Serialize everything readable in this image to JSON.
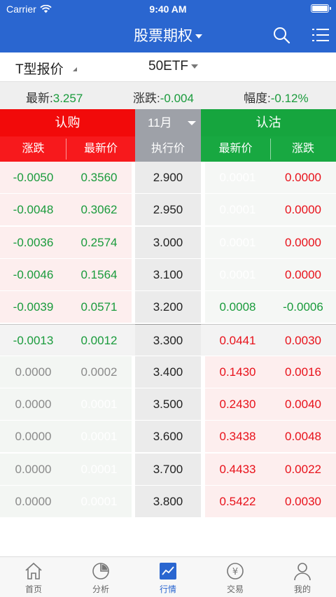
{
  "status_bar": {
    "carrier": "Carrier",
    "time": "9:40 AM"
  },
  "nav": {
    "title": "股票期权",
    "search_icon": "search-icon",
    "menu_icon": "list-menu-icon"
  },
  "filter": {
    "type": "T型报价",
    "underlying": "50ETF"
  },
  "quote": {
    "last_label": "最新:",
    "last_value": "3.257",
    "change_label": "涨跌:",
    "change_value": "-0.004",
    "pct_label": "幅度:",
    "pct_value": "-0.12%"
  },
  "table": {
    "call_header": "认购",
    "month": "11月",
    "put_header": "认沽",
    "columns": {
      "call_change": "涨跌",
      "call_last": "最新价",
      "strike": "执行价",
      "put_last": "最新价",
      "put_change": "涨跌"
    },
    "rows": [
      {
        "call_change": "-0.0050",
        "call_last": "0.3560",
        "strike": "2.900",
        "put_last": "0.0001",
        "put_change": "0.0000"
      },
      {
        "call_change": "-0.0048",
        "call_last": "0.3062",
        "strike": "2.950",
        "put_last": "0.0001",
        "put_change": "0.0000"
      },
      {
        "call_change": "-0.0036",
        "call_last": "0.2574",
        "strike": "3.000",
        "put_last": "0.0001",
        "put_change": "0.0000"
      },
      {
        "call_change": "-0.0046",
        "call_last": "0.1564",
        "strike": "3.100",
        "put_last": "0.0001",
        "put_change": "0.0000"
      },
      {
        "call_change": "-0.0039",
        "call_last": "0.0571",
        "strike": "3.200",
        "put_last": "0.0008",
        "put_change": "-0.0006"
      },
      {
        "call_change": "-0.0013",
        "call_last": "0.0012",
        "strike": "3.300",
        "put_last": "0.0441",
        "put_change": "0.0030"
      },
      {
        "call_change": "0.0000",
        "call_last": "0.0002",
        "strike": "3.400",
        "put_last": "0.1430",
        "put_change": "0.0016"
      },
      {
        "call_change": "0.0000",
        "call_last": "0.0001",
        "strike": "3.500",
        "put_last": "0.2430",
        "put_change": "0.0040"
      },
      {
        "call_change": "0.0000",
        "call_last": "0.0001",
        "strike": "3.600",
        "put_last": "0.3438",
        "put_change": "0.0048"
      },
      {
        "call_change": "0.0000",
        "call_last": "0.0001",
        "strike": "3.700",
        "put_last": "0.4433",
        "put_change": "0.0022"
      },
      {
        "call_change": "0.0000",
        "call_last": "0.0001",
        "strike": "3.800",
        "put_last": "0.5422",
        "put_change": "0.0030"
      }
    ]
  },
  "tabbar": {
    "items": [
      {
        "label": "首页",
        "icon": "home-icon"
      },
      {
        "label": "分析",
        "icon": "pie-chart-icon"
      },
      {
        "label": "行情",
        "icon": "market-chart-icon",
        "active": true
      },
      {
        "label": "交易",
        "icon": "yen-coin-icon"
      },
      {
        "label": "我的",
        "icon": "user-icon"
      }
    ]
  },
  "colors": {
    "header_blue": "#2a66d0",
    "call_red": "#f20a0a",
    "put_green": "#16a53e",
    "strike_gray": "#9ea1a8"
  }
}
